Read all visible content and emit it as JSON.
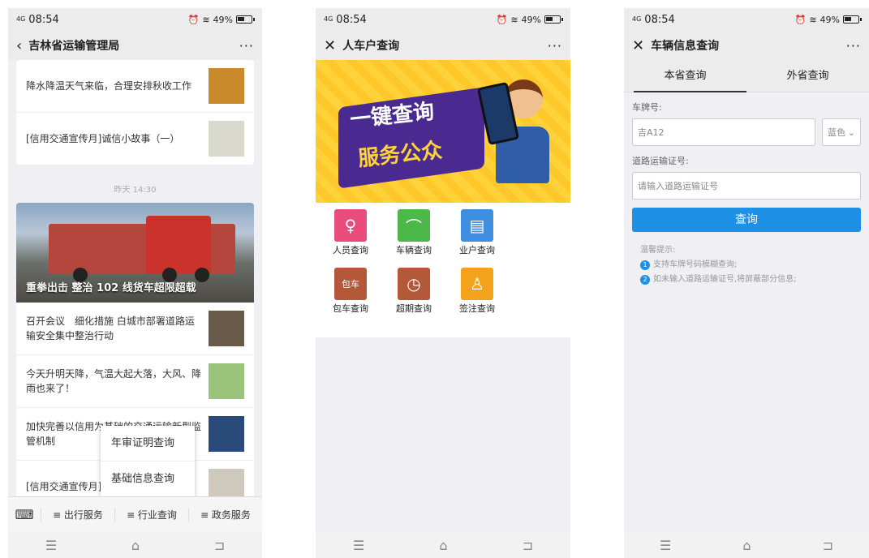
{
  "status": {
    "time": "08:54",
    "signal": "4G",
    "battery": "49%"
  },
  "screen1": {
    "title": "吉林省运输管理局",
    "more": "···",
    "top_news": [
      {
        "text": "降水降温天气来临，合理安排秋收工作",
        "thumb_color": "#c98a2b"
      },
      {
        "text": "[信用交通宣传月]诚信小故事（一）",
        "thumb_color": "#d8d8cc"
      }
    ],
    "time_label": "昨天 14:30",
    "hero_caption": "重拳出击 整治 102 线货车超限超载",
    "news": [
      {
        "text": "召开会议　细化措施 白城市部署道路运输安全集中整治行动",
        "thumb_color": "#6a5a4a"
      },
      {
        "text": "今天升明天降，气温大起大落，大风、降雨也来了！",
        "thumb_color": "#9ac47a"
      },
      {
        "text": "加快完善以信用为基础的交通运输新型监管机制",
        "thumb_color": "#2a4a7a"
      },
      {
        "text": "[信用交通宣传月]",
        "thumb_color": "#cfc9bd"
      }
    ],
    "popup": [
      "年审证明查询",
      "基础信息查询"
    ],
    "menu": [
      "≡ 出行服务",
      "≡ 行业查询",
      "≡ 政务服务"
    ]
  },
  "screen2": {
    "title": "人车户查询",
    "more": "···",
    "banner_line1": "一键查询",
    "banner_line2": "服务公众",
    "icons": [
      {
        "label": "人员查询",
        "color": "#e94b7a",
        "glyph": "♀"
      },
      {
        "label": "车辆查询",
        "color": "#4cb84a",
        "glyph": "⌒"
      },
      {
        "label": "业户查询",
        "color": "#3f8fe0",
        "glyph": "▤"
      },
      {
        "label": "包车查询",
        "color": "#b5583a",
        "glyph": "包车"
      },
      {
        "label": "超期查询",
        "color": "#b5583a",
        "glyph": "◷"
      },
      {
        "label": "签注查询",
        "color": "#f3a21c",
        "glyph": "♙"
      }
    ]
  },
  "screen3": {
    "title": "车辆信息查询",
    "more": "···",
    "tabs": [
      "本省查询",
      "外省查询"
    ],
    "plate_label": "车牌号:",
    "plate_value": "吉A12",
    "color_select": "蓝色",
    "license_label": "道路运输证号:",
    "license_placeholder": "请输入道路运输证号",
    "submit": "查询",
    "tips_title": "温馨提示:",
    "tips": [
      "支持车牌号码模糊查询;",
      "如未输入道路运输证号,将屏蔽部分信息;"
    ]
  },
  "nav": {
    "menu": "☰",
    "home": "⌂",
    "back": "⊐"
  }
}
